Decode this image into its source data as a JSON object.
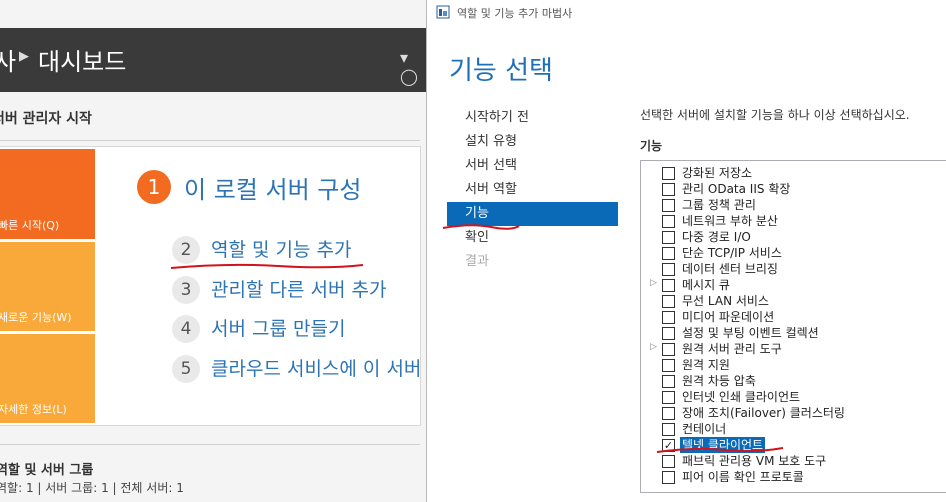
{
  "server_manager": {
    "breadcrumb_prefix": "사",
    "breadcrumb_title": "대시보드",
    "welcome_title": "서버 관리자 시작",
    "tiles": [
      {
        "label": "빠른 시작(Q)",
        "color": "#f26b21"
      },
      {
        "label": "새로운 기능(W)",
        "color": "#f9a93a"
      },
      {
        "label": "자세한 정보(L)",
        "color": "#f9a93a"
      }
    ],
    "step1": {
      "number": "1",
      "title": "이 로컬 서버 구성"
    },
    "steps": [
      {
        "number": "2",
        "label": "역할 및 기능 추가"
      },
      {
        "number": "3",
        "label": "관리할 다른 서버 추가"
      },
      {
        "number": "4",
        "label": "서버 그룹 만들기"
      },
      {
        "number": "5",
        "label": "클라우드 서비스에 이 서버"
      }
    ],
    "roles_title": "역할 및 서버 그룹",
    "roles_summary": "역할: 1  |  서버 그룹: 1  |  전체 서버: 1"
  },
  "wizard": {
    "window_title": "역할 및 기능 추가 마법사",
    "heading": "기능 선택",
    "nav": [
      {
        "label": "시작하기 전",
        "state": "normal"
      },
      {
        "label": "설치 유형",
        "state": "normal"
      },
      {
        "label": "서버 선택",
        "state": "normal"
      },
      {
        "label": "서버 역할",
        "state": "normal"
      },
      {
        "label": "기능",
        "state": "active"
      },
      {
        "label": "확인",
        "state": "normal"
      },
      {
        "label": "결과",
        "state": "disabled"
      }
    ],
    "description": "선택한 서버에 설치할 기능을 하나 이상 선택하십시오.",
    "features_label": "기능",
    "features": [
      {
        "label": "강화된 저장소",
        "checked": false,
        "expandable": false
      },
      {
        "label": "관리 OData IIS 확장",
        "checked": false,
        "expandable": false
      },
      {
        "label": "그룹 정책 관리",
        "checked": false,
        "expandable": false
      },
      {
        "label": "네트워크 부하 분산",
        "checked": false,
        "expandable": false
      },
      {
        "label": "다중 경로 I/O",
        "checked": false,
        "expandable": false
      },
      {
        "label": "단순 TCP/IP 서비스",
        "checked": false,
        "expandable": false
      },
      {
        "label": "데이터 센터 브리징",
        "checked": false,
        "expandable": false
      },
      {
        "label": "메시지 큐",
        "checked": false,
        "expandable": true
      },
      {
        "label": "무선 LAN 서비스",
        "checked": false,
        "expandable": false
      },
      {
        "label": "미디어 파운데이션",
        "checked": false,
        "expandable": false
      },
      {
        "label": "설정 및 부팅 이벤트 컬렉션",
        "checked": false,
        "expandable": false
      },
      {
        "label": "원격 서버 관리 도구",
        "checked": false,
        "expandable": true
      },
      {
        "label": "원격 지원",
        "checked": false,
        "expandable": false
      },
      {
        "label": "원격 차등 압축",
        "checked": false,
        "expandable": false
      },
      {
        "label": "인터넷 인쇄 클라이언트",
        "checked": false,
        "expandable": false
      },
      {
        "label": "장애 조치(Failover) 클러스터링",
        "checked": false,
        "expandable": false
      },
      {
        "label": "컨테이너",
        "checked": false,
        "expandable": false
      },
      {
        "label": "텔넷 클라이언트",
        "checked": true,
        "expandable": false,
        "selected": true
      },
      {
        "label": "패브릭 관리용 VM 보호 도구",
        "checked": false,
        "expandable": false
      },
      {
        "label": "피어 이름 확인 프로토콜",
        "checked": false,
        "expandable": false
      }
    ]
  },
  "colors": {
    "accent": "#0a6ab8",
    "heading_blue": "#1e6fb5",
    "orange": "#f26b21",
    "light_orange": "#f9a93a",
    "annotation_red": "#d0141c"
  }
}
